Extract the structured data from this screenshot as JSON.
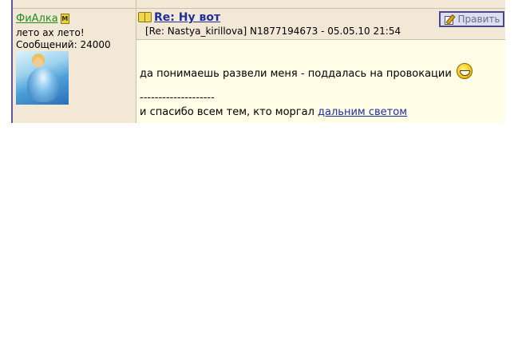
{
  "post": {
    "author": {
      "name": "ФиАлка",
      "badge": "M",
      "status": "лето ах лето!",
      "posts_label": "Сообщений: 24000"
    },
    "title": "Re: Ну вот",
    "meta": "[Re: Nastya_kirillova]  N1877194673 - 05.05.10 21:54",
    "edit_label": "Править",
    "body_text": "да понимаешь развели меня - поддалась на провокации",
    "signature": {
      "separator": "--------------------",
      "text": "и спасибо всем тем, кто моргал ",
      "link_text": "дальним светом"
    }
  },
  "colors": {
    "panel_bg": "#f3e7d6",
    "message_bg": "#fffde6",
    "link": "#1f2e9e",
    "author_link": "#1e8f1e",
    "frame_border": "#5a5aa8"
  },
  "icons": [
    "moderator-badge-icon",
    "book-icon",
    "pencil-icon",
    "smiley-icon"
  ]
}
